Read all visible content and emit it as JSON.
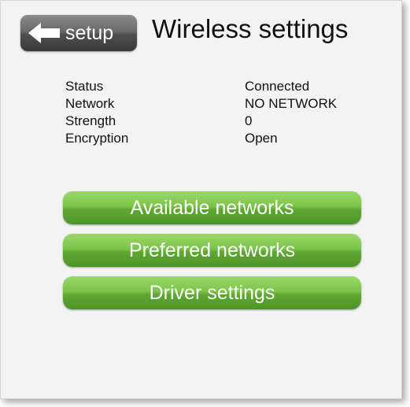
{
  "header": {
    "back_label": "setup",
    "title": "Wireless settings"
  },
  "status": {
    "rows": [
      {
        "key": "Status",
        "value": "Connected"
      },
      {
        "key": "Network",
        "value": "NO NETWORK"
      },
      {
        "key": "Strength",
        "value": "0"
      },
      {
        "key": "Encryption",
        "value": "Open"
      }
    ]
  },
  "actions": {
    "available": "Available networks",
    "preferred": "Preferred networks",
    "driver": "Driver settings"
  },
  "colors": {
    "button_green": "#6cb83d",
    "back_gray": "#5a5a5a",
    "background": "#f3f3f4"
  },
  "icons": {
    "back": "arrow-left-icon"
  }
}
